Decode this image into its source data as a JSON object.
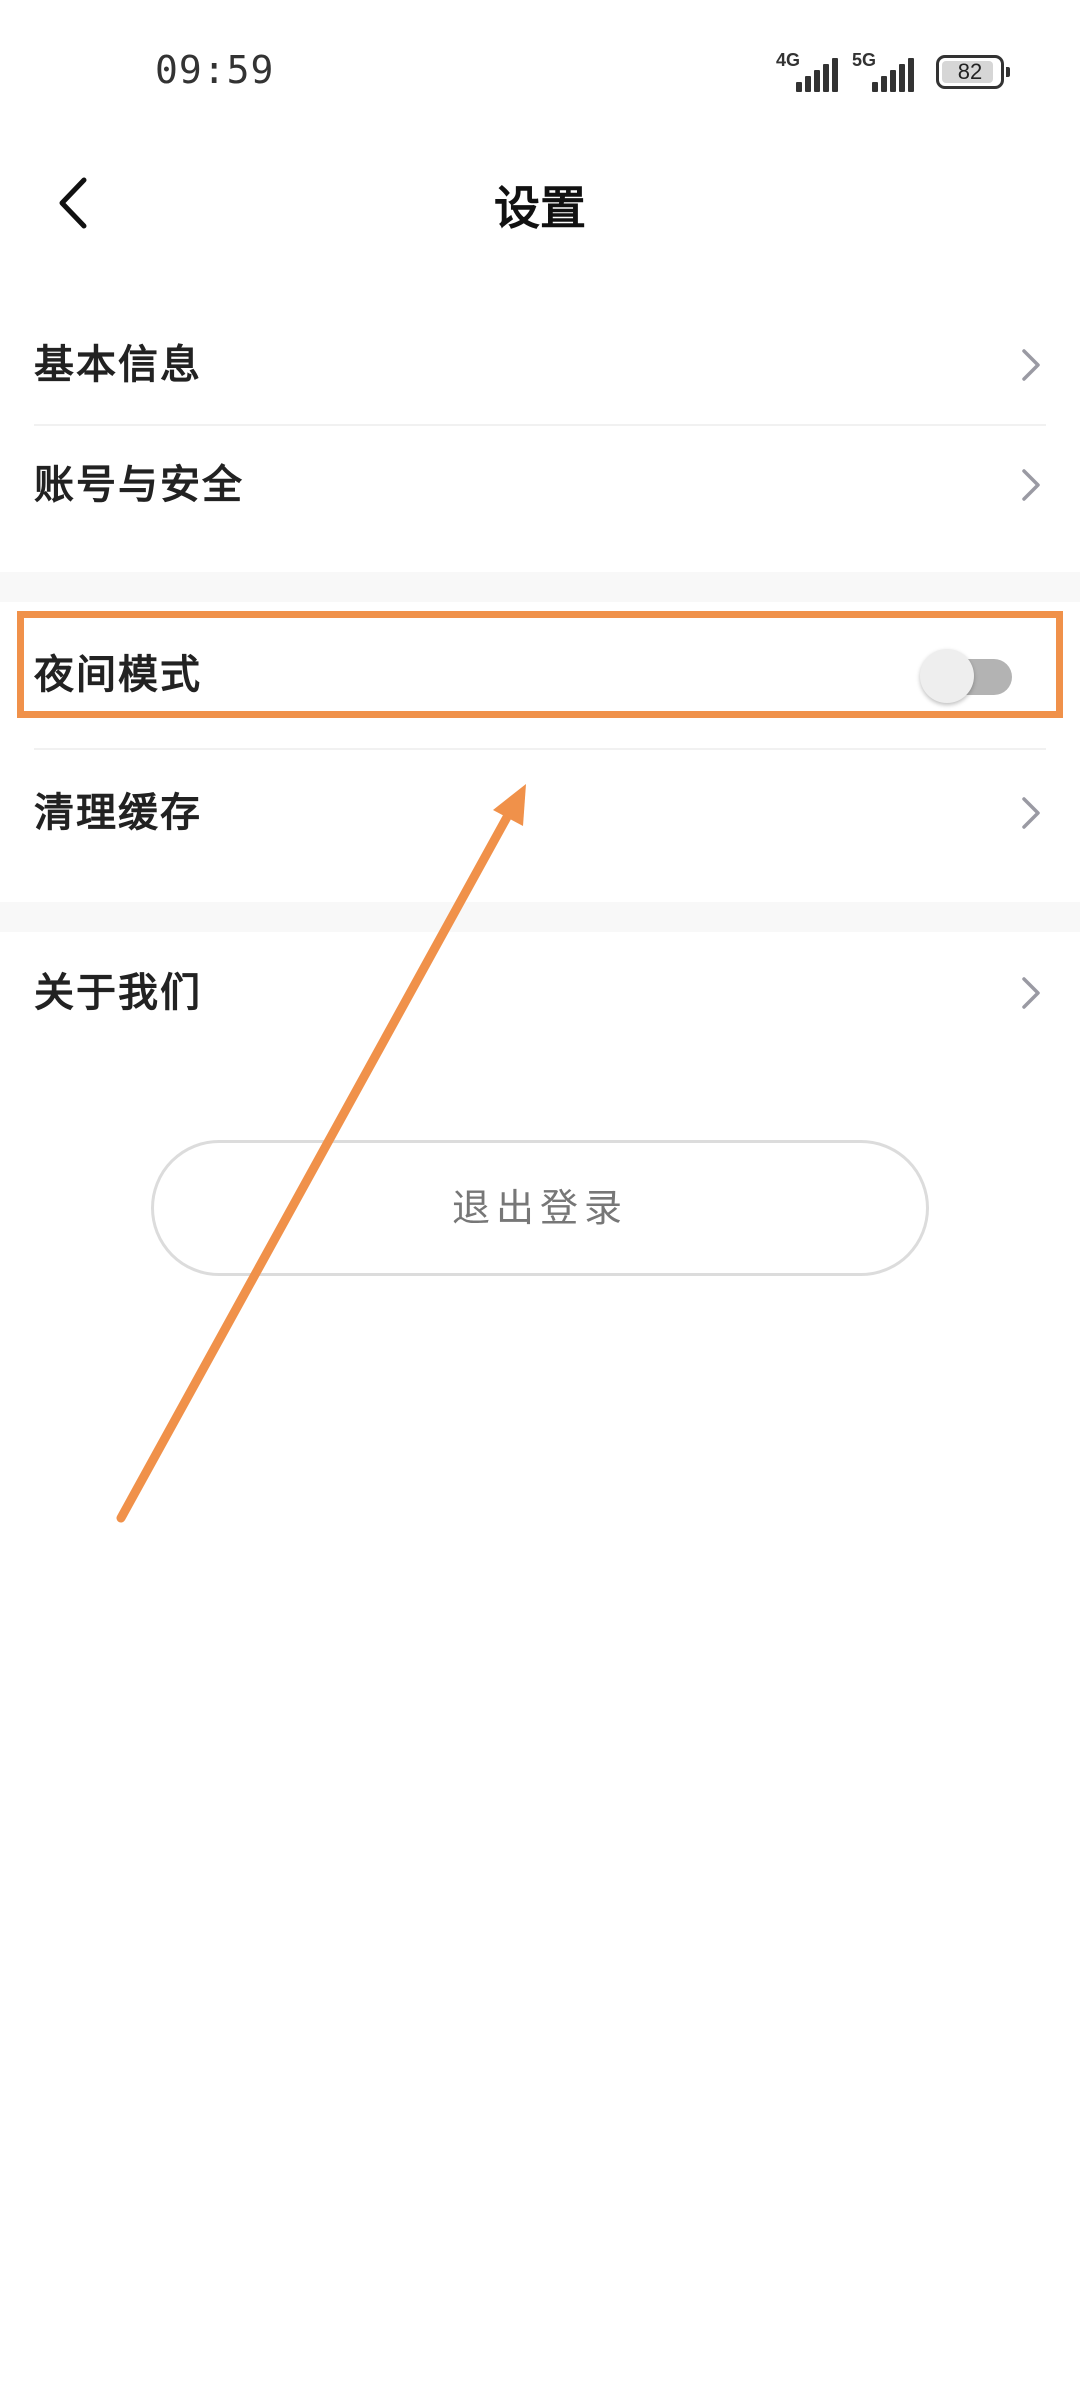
{
  "status_bar": {
    "time": "09:59",
    "signal_1_label": "4G",
    "signal_2_label": "5G",
    "battery_level": "82"
  },
  "header": {
    "title": "设置",
    "back_icon": "chevron-left-icon"
  },
  "settings": {
    "group1": [
      {
        "label": "基本信息",
        "icon": "chevron-right-icon"
      },
      {
        "label": "账号与安全",
        "icon": "chevron-right-icon"
      }
    ],
    "group2": {
      "night_mode": {
        "label": "夜间模式",
        "enabled": false
      },
      "clear_cache": {
        "label": "清理缓存",
        "icon": "chevron-right-icon"
      }
    },
    "group3": [
      {
        "label": "关于我们",
        "icon": "chevron-right-icon"
      }
    ]
  },
  "logout_label": "退出登录",
  "colors": {
    "annotation": "#f0914a",
    "toggle_off_track": "#b3b3b3",
    "section_gap": "#f8f8f8"
  }
}
